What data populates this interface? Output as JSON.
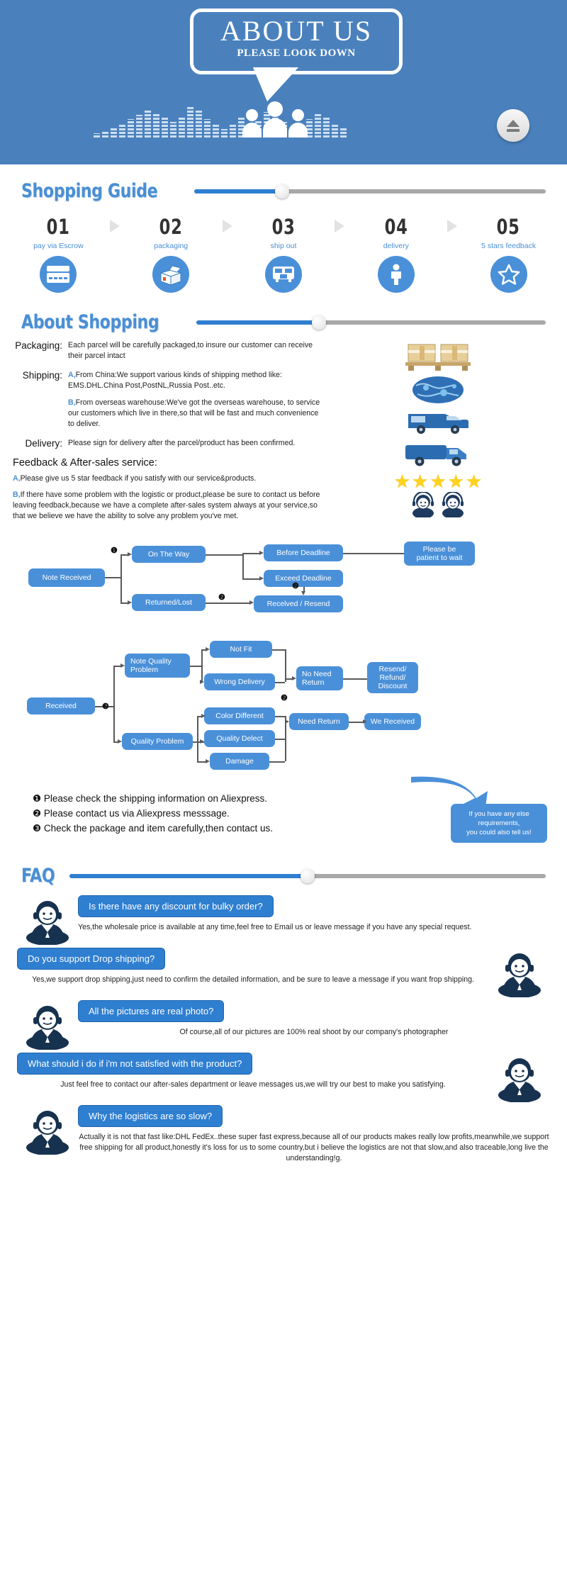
{
  "hero": {
    "title": "ABOUT US",
    "subtitle": "PLEASE LOOK DOWN",
    "eject_icon": "eject-icon",
    "people_icon": "people-group-icon",
    "equalizer_icon": "equalizer-bars-icon"
  },
  "shopping_guide": {
    "title": "Shopping Guide",
    "slider_percent": 25,
    "steps": [
      {
        "num": "01",
        "label": "pay via Escrow",
        "icon": "credit-card-icon"
      },
      {
        "num": "02",
        "label": "packaging",
        "icon": "open-box-icon"
      },
      {
        "num": "03",
        "label": "ship out",
        "icon": "truck-icon"
      },
      {
        "num": "04",
        "label": "delivery",
        "icon": "person-delivery-icon"
      },
      {
        "num": "05",
        "label": "5 stars feedback",
        "icon": "star-outline-icon"
      }
    ]
  },
  "about_shopping": {
    "title": "About Shopping",
    "slider_percent": 35,
    "rows": [
      {
        "label": "Packaging:",
        "paragraphs": [
          {
            "prefix": "",
            "text": "Each parcel will be carefully packaged,to insure our customer can receive their parcel intact"
          }
        ]
      },
      {
        "label": "Shipping:",
        "paragraphs": [
          {
            "prefix": "A,",
            "text": "From China:We support various kinds of shipping method like: EMS.DHL.China Post,PostNL,Russia Post..etc."
          },
          {
            "prefix": "B,",
            "text": "From overseas warehouse:We've got the overseas warehouse, to service our customers which live in there,so that will be fast and much convenience to deliver."
          }
        ]
      },
      {
        "label": "Delivery:",
        "paragraphs": [
          {
            "prefix": "",
            "text": "Please sign for delivery after the parcel/product has been confirmed."
          }
        ]
      }
    ],
    "feedback_title": "Feedback & After-sales service:",
    "feedback_lines": [
      {
        "prefix": "A,",
        "text": "Please give us 5 star feedback if you satisfy with our service&products."
      },
      {
        "prefix": "B,",
        "text": "If there have some problem with the logistic or product,please be sure to contact us before leaving feedback,because we have a complete after-sales system always at your service,so that we believe we have the ability to solve any problem you've met."
      }
    ],
    "side_icons": [
      "pallet-boxes-icon",
      "globe-world-icon",
      "blue-van-icon",
      "blue-truck-icon"
    ],
    "stars_count": 5,
    "agents_icon": "support-agents-icon"
  },
  "flow1": {
    "nodes": {
      "note_received": "Note Received",
      "on_the_way": "On The Way",
      "returned_lost": "Returned/Lost",
      "before_deadline": "Before Deadline",
      "exceed_deadline": "Exceed Deadline",
      "received_resend": "Recelved / Resend",
      "please_be_patient": "Please be\npatient to wait"
    },
    "badges": {
      "b1": "❶",
      "b2a": "❷",
      "b2b": "❷"
    }
  },
  "flow2": {
    "nodes": {
      "received": "Received",
      "note_quality_problem": "Note Quality\nProblem",
      "quality_problem": "Quality Problem",
      "not_fit": "Not Fit",
      "wrong_delivery": "Wrong Delivery",
      "color_different": "Color Different",
      "quality_delect": "Quality Delect",
      "damage": "Damage",
      "no_need_return": "No Need\nReturn",
      "need_return": "Need Return",
      "resend_refund_discount": "Resend/\nRefund/\nDiscount",
      "we_received": "We Received"
    },
    "badges": {
      "b3": "❸",
      "b2": "❷"
    }
  },
  "notes": {
    "lines": [
      {
        "badge": "❶",
        "text": "Please check the shipping information on Aliexpress."
      },
      {
        "badge": "❷",
        "text": "Please contact us via Aliexpress messsage."
      },
      {
        "badge": "❸",
        "text": "Check the package and item carefully,then contact us."
      }
    ],
    "callout": "If you have any else\nrequirements,\nyou could also tell us!"
  },
  "faq": {
    "title": "FAQ",
    "slider_percent": 50,
    "items": [
      {
        "question": "Is there have any discount for bulky order?",
        "answer": "Yes,the wholesale price is available at any time,feel free to Email us or leave message if you have any special request.",
        "avatar_side": "left",
        "answer_align": "left",
        "avatar": "support-agent-avatar"
      },
      {
        "question": "Do you support Drop shipping?",
        "answer": "Yes,we support drop shipping,just need to confirm the detailed information, and be sure to leave a message if you want frop shipping.",
        "avatar_side": "right",
        "answer_align": "center",
        "avatar": "support-agent-avatar"
      },
      {
        "question": "All the pictures are real photo?",
        "answer": "Of course,all of our pictures are 100% real shoot by our company's photographer",
        "avatar_side": "left",
        "answer_align": "center",
        "avatar": "support-agent-avatar"
      },
      {
        "question": "What should i do if i'm not satisfied with the product?",
        "answer": "Just feel free to contact our after-sales department or leave messages us,we will try our best to make you satisfying.",
        "avatar_side": "right",
        "answer_align": "center",
        "avatar": "support-agent-avatar"
      },
      {
        "question": "Why the logistics are so slow?",
        "answer": "Actually it is not that fast like:DHL FedEx..these super fast express,because all of our products makes really low profits,meanwhile,we support free shipping for all product,honestly it's loss for us to some country,but i believe the logistics are not that slow,and also traceable,long live the understanding!g.",
        "avatar_side": "left",
        "answer_align": "center",
        "avatar": "support-agent-avatar"
      }
    ]
  },
  "colors": {
    "brand_blue": "#4a81bd",
    "accent_blue": "#4a90d9",
    "title_blue": "#4a8fd4",
    "slider_blue": "#2f7fd1",
    "star_yellow": "#ffd21e"
  }
}
